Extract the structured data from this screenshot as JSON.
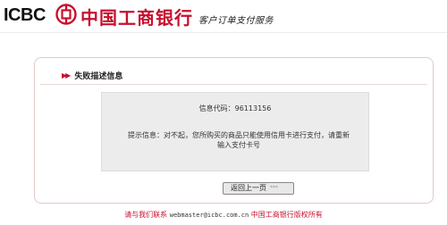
{
  "header": {
    "logo_text": "ICBC",
    "bank_name": "中国工商银行",
    "subtitle": "客户订单支付服务"
  },
  "panel": {
    "title": "失败描述信息",
    "code_label": "信息代码：",
    "code_value": "96113156",
    "tip_line1": "提示信息：对不起，您所购买的商品只能使用信用卡进行支付，请重新",
    "tip_line2": "输入支付卡号",
    "back_button": "返回上一页",
    "back_button_dots": "***"
  },
  "footer": {
    "contact_label": "请与我们联系",
    "email": "webmaster@icbc.com.cn",
    "copyright": "中国工商银行版权所有"
  },
  "colors": {
    "brand": "#c8102e"
  }
}
